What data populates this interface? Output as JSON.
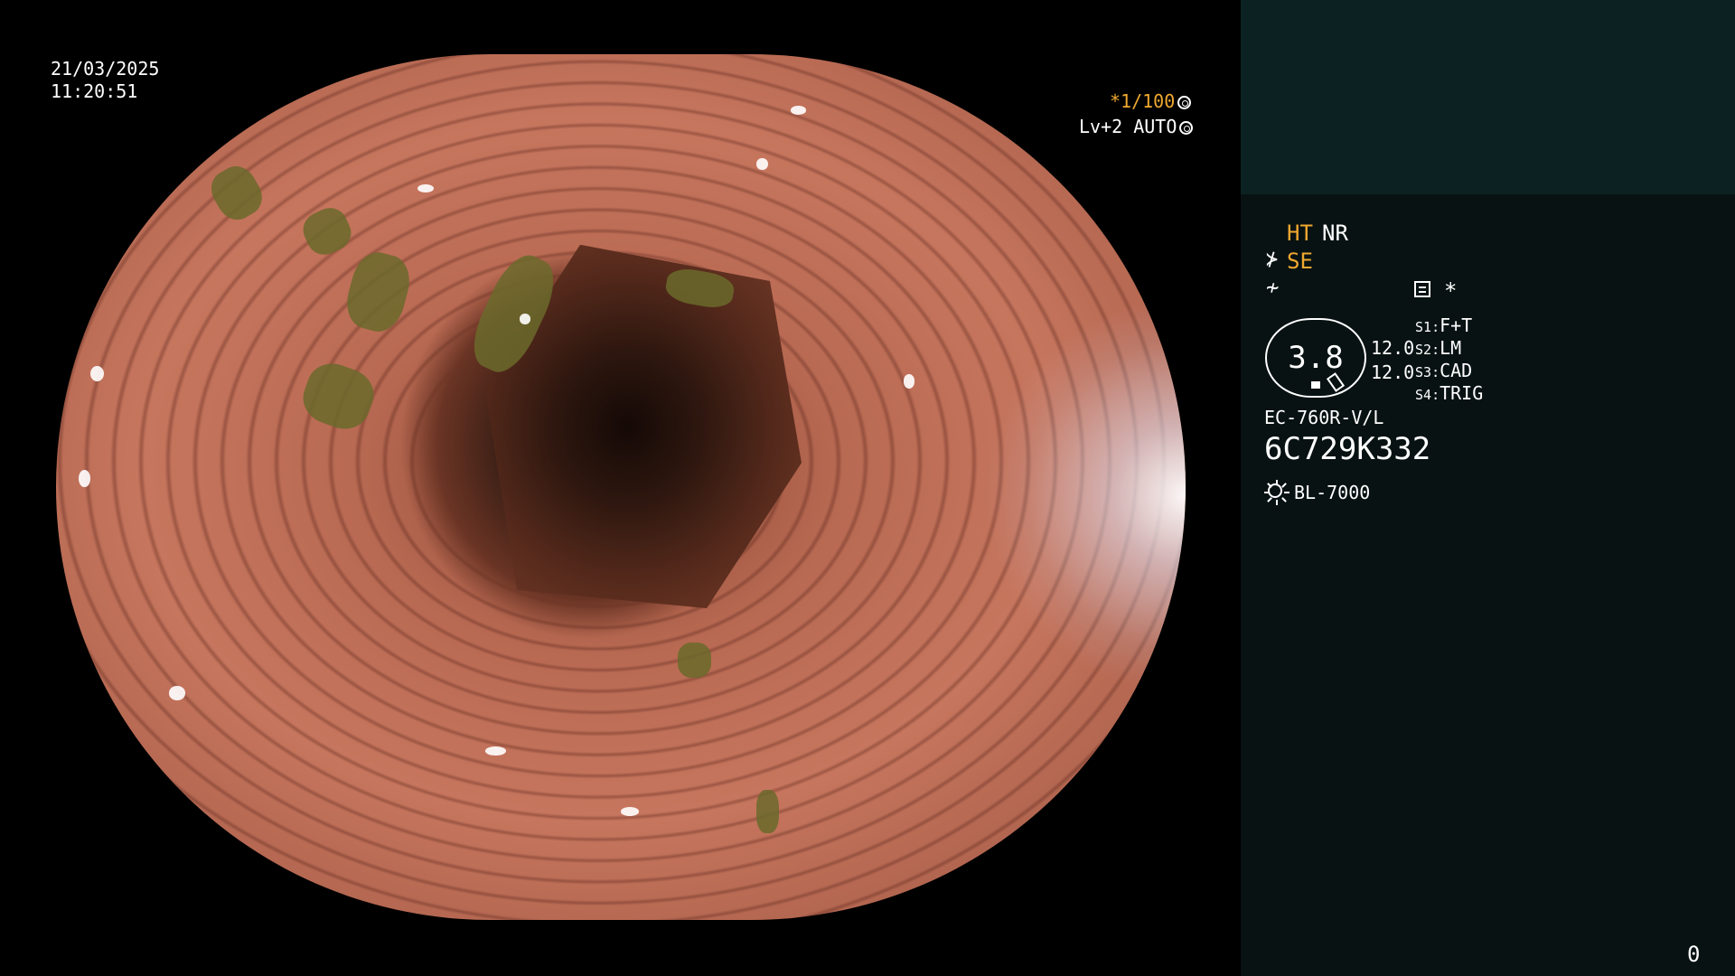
{
  "video_overlay": {
    "date": "21/03/2025",
    "time": "11:20:51",
    "shutter": "*1/100",
    "level": "Lv+2 AUTO"
  },
  "info_panel": {
    "ht_label": "HT",
    "nr_label": "NR",
    "se_label": "SE",
    "asterisk": "*",
    "zoom": {
      "value": "3.8",
      "top": "12.0",
      "bottom": "12.0"
    },
    "switches": [
      {
        "key": "S1",
        "value": "F+T"
      },
      {
        "key": "S2",
        "value": "LM"
      },
      {
        "key": "S3",
        "value": "CAD"
      },
      {
        "key": "S4",
        "value": "TRIG"
      }
    ],
    "scope_model": "EC-760R-V/L",
    "scope_serial": "6C729K332",
    "light_source": "BL-7000"
  },
  "page_counter": "0",
  "colors": {
    "accent_orange": "#f0a830",
    "panel_bg": "#081212",
    "panel_top_bg": "#0c2222"
  },
  "icons": [
    "shutter-wheel-icon",
    "auto-iris-icon",
    "structure-enhance-icon",
    "flash-icon",
    "memo-icon",
    "light-source-icon"
  ]
}
